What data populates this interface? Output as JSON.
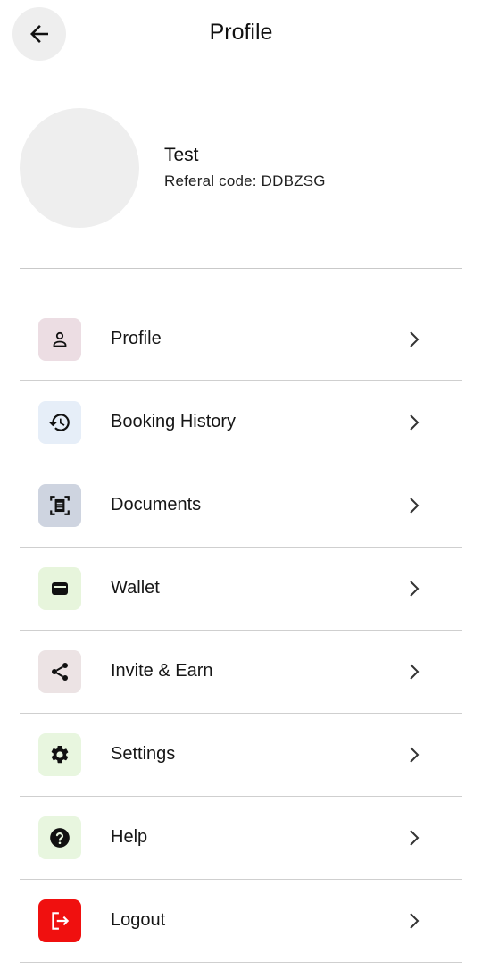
{
  "header": {
    "title": "Profile",
    "back_icon": "arrow-left-icon"
  },
  "user": {
    "name": "Test",
    "referral_text": "Referal code: DDBZSG"
  },
  "menu": {
    "items": [
      {
        "label": "Profile",
        "icon": "person-icon",
        "bg": "#ecdde3"
      },
      {
        "label": "Booking History",
        "icon": "history-icon",
        "bg": "#e6eef8"
      },
      {
        "label": "Documents",
        "icon": "document-scan-icon",
        "bg": "#ced4e0"
      },
      {
        "label": "Wallet",
        "icon": "wallet-icon",
        "bg": "#e7f5dc"
      },
      {
        "label": "Invite & Earn",
        "icon": "share-icon",
        "bg": "#ece3e4"
      },
      {
        "label": "Settings",
        "icon": "gear-icon",
        "bg": "#e8f6df"
      },
      {
        "label": "Help",
        "icon": "help-circle-icon",
        "bg": "#e8f6df"
      },
      {
        "label": "Logout",
        "icon": "logout-icon",
        "bg": "#f0100f"
      }
    ]
  }
}
